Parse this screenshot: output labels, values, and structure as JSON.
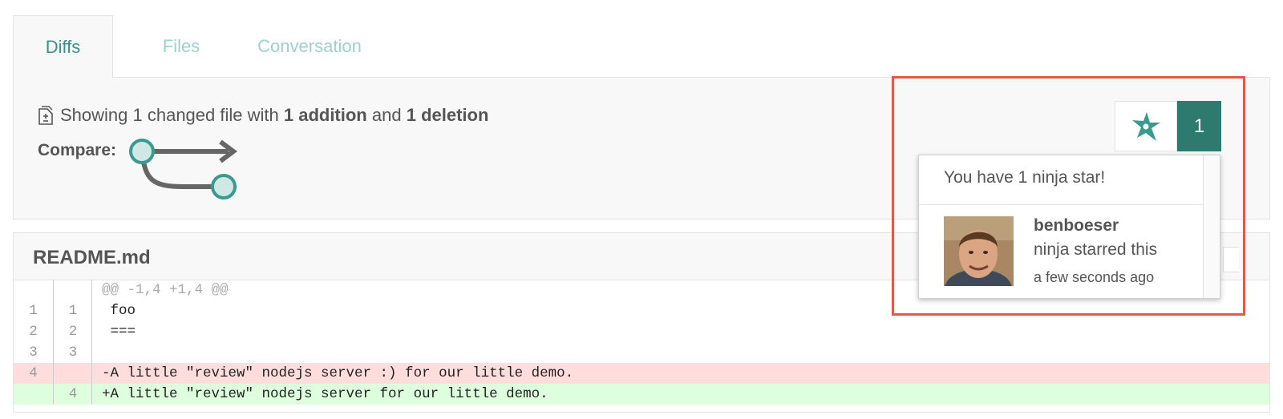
{
  "tabs": [
    {
      "label": "Diffs",
      "active": true
    },
    {
      "label": "Files",
      "active": false
    },
    {
      "label": "Conversation",
      "active": false
    }
  ],
  "summary": {
    "prefix": "Showing 1 changed file with ",
    "additions": "1 addition",
    "middle": " and ",
    "deletions": "1 deletion",
    "compare_label": "Compare:"
  },
  "file": {
    "name": "README.md",
    "hunk": "@@ -1,4 +1,4 @@",
    "rows": [
      {
        "type": "context",
        "old": "1",
        "new": "1",
        "code": " foo"
      },
      {
        "type": "context",
        "old": "2",
        "new": "2",
        "code": " ==="
      },
      {
        "type": "context",
        "old": "3",
        "new": "3",
        "code": " "
      },
      {
        "type": "del",
        "old": "4",
        "new": "",
        "code": "-A little \"review\" nodejs server :) for our little demo."
      },
      {
        "type": "add",
        "old": "",
        "new": "4",
        "code": "+A little \"review\" nodejs server for our little demo."
      }
    ]
  },
  "ninja_star": {
    "icon": "ninja-star-icon",
    "count": "1",
    "popup_title": "You have 1 ninja star!",
    "entry": {
      "user": "benboeser",
      "action": "ninja starred this",
      "time": "a few seconds ago"
    }
  },
  "colors": {
    "accent": "#3a8f88",
    "count_bg": "#2e7a6e",
    "highlight": "#e2584a",
    "del_bg": "#ffdddd",
    "add_bg": "#ddffdd"
  }
}
